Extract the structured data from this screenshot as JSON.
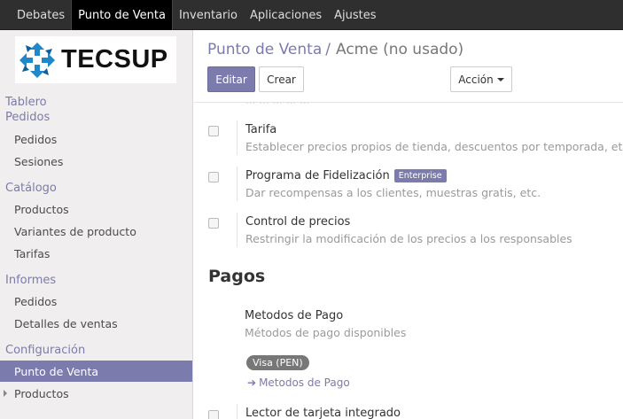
{
  "topbar": {
    "items": [
      {
        "label": "Debates",
        "active": false
      },
      {
        "label": "Punto de Venta",
        "active": true
      },
      {
        "label": "Inventario",
        "active": false
      },
      {
        "label": "Aplicaciones",
        "active": false
      },
      {
        "label": "Ajustes",
        "active": false
      }
    ]
  },
  "logo": {
    "text": "TECSUP"
  },
  "sidebar": {
    "heads": [
      "Tablero",
      "Pedidos",
      "Catálogo",
      "Informes",
      "Configuración"
    ],
    "pedidos": [
      "Pedidos",
      "Sesiones"
    ],
    "catalogo": [
      "Productos",
      "Variantes de producto",
      "Tarifas"
    ],
    "informes": [
      "Pedidos",
      "Detalles de ventas"
    ],
    "configuracion": [
      "Punto de Venta",
      "Productos"
    ]
  },
  "breadcrumb": {
    "parent": "Punto de Venta",
    "separator": "/",
    "current": "Acme (no usado)"
  },
  "buttons": {
    "edit": "Editar",
    "create": "Crear",
    "action": "Acción"
  },
  "settings": [
    {
      "title": "Tarifa",
      "description": "Establecer precios propios de tienda, descuentos por temporada, etc.",
      "badge": ""
    },
    {
      "title": "Programa de Fidelización",
      "description": "Dar recompensas a los clientes, muestras gratis, etc.",
      "badge": "Enterprise"
    },
    {
      "title": "Control de precios",
      "description": "Restringir la modificación de los precios a los responsables",
      "badge": ""
    }
  ],
  "pagos": {
    "section_title": "Pagos",
    "title": "Metodos de Pago",
    "description": "Métodos de pago disponibles",
    "tag": "Visa (PEN)",
    "link": "Metodos de Pago"
  },
  "bottom_setting": {
    "title": "Lector de tarjeta integrado"
  },
  "colors": {
    "accent": "#7c7bad",
    "topbar": "#2f2f2f",
    "sidebar": "#f0eeee"
  }
}
